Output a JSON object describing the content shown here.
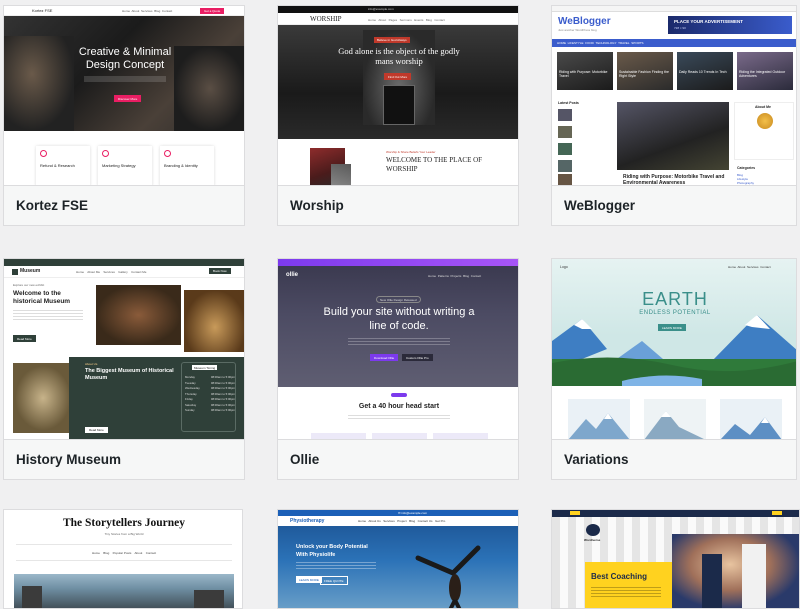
{
  "themes": [
    {
      "name": "Kortez FSE"
    },
    {
      "name": "Worship"
    },
    {
      "name": "WeBlogger"
    },
    {
      "name": "History Museum"
    },
    {
      "name": "Ollie"
    },
    {
      "name": "Variations"
    },
    {
      "name": "The Storytellers Journey"
    },
    {
      "name": "Physiotherapy"
    },
    {
      "name": "Best Coaching"
    }
  ],
  "kortez": {
    "logo": "Kortez FSE",
    "nav": [
      "Home",
      "About",
      "Services",
      "Blog",
      "Contact"
    ],
    "cta": "Get a Quote",
    "hero_title": "Creative & Minimal Design Concept",
    "hero_btn": "Discover More",
    "features": [
      "Refund & Research",
      "Marketing Strategy",
      "Branding & Identity"
    ]
  },
  "worship": {
    "logo": "WORSHIP",
    "topbar": "info@example.com",
    "hero_label": "Believe in God Always",
    "hero_title": "God alone is the object of the godly mans worship",
    "hero_btn": "Find Out More",
    "welcome_label": "Worship & Share Beliefs Your Leader",
    "welcome_title": "WELCOME TO THE PLACE OF WORSHIP"
  },
  "weblogger": {
    "logo": "WeBlogger",
    "tagline": "Just another WordPress blog",
    "ad": "PLACE YOUR ADVERTISEMENT",
    "ad_size": "728 × 90",
    "nav": [
      "HOME",
      "LIFESTYLE",
      "FOOD",
      "TECHNOLOGY",
      "TRAVEL",
      "SPORTS"
    ],
    "latest": "Latest Posts",
    "feature_title": "Riding with Purpose: Motorbike Travel and Environmental Awareness",
    "about": "About Me",
    "categories": "Categories",
    "cat_items": [
      "Blog",
      "Lifestyle",
      "Photography"
    ],
    "posts": [
      "Riding with Purpose: Motorbike Travel",
      "Sustainable Fashion Finding the Right Style",
      "Daily Reads 10 Trends In Tech",
      "Riding the Integrated Outdoor Adventures"
    ]
  },
  "museum": {
    "logo": "Museum",
    "nav": [
      "Home",
      "About Me",
      "Services",
      "Gallery",
      "Contact Me"
    ],
    "btn": "Book Now",
    "eyebrow": "Explore our new exhibit",
    "hero_title": "Welcome to the historical Museum",
    "hero_btn": "Read More",
    "about_label": "About Us",
    "about_title": "The Biggest Museum of Historical Museum",
    "about_btn": "Read More",
    "timing_title": "Museum Timing",
    "days": [
      "Monday",
      "Tuesday",
      "Wednesday",
      "Thursday",
      "Friday",
      "Saturday",
      "Sunday"
    ],
    "hours": "08:00am to 5:00pm"
  },
  "ollie": {
    "logo": "ollie",
    "nav": [
      "Home",
      "Patterns",
      "Projects",
      "Blog",
      "Contact"
    ],
    "badge": "New Ollie Design Released",
    "hero_title": "Build your site without writing a line of code.",
    "btn1": "Download Ollie",
    "btn2": "Custom Ollie Pro",
    "sub_title": "Get a 40 hour head start"
  },
  "variations": {
    "logo": "Logo",
    "nav": [
      "Home",
      "About",
      "Services",
      "Contact"
    ],
    "title": "EARTH",
    "subtitle": "ENDLESS POTENTIAL",
    "btn": "LEARN MORE"
  },
  "story": {
    "title": "The Storytellers Journey",
    "tagline": "Tiny Stories from a Big World",
    "nav": [
      "Home",
      "Blog",
      "Popular Posts",
      "About",
      "Contact"
    ]
  },
  "physio": {
    "logo": "Physiotherapy",
    "nav": [
      "Home",
      "About Us",
      "Services",
      "Project",
      "Blog",
      "Contact Us",
      "Get Pro"
    ],
    "hero_title": "Unlock your Body Potential With Physiolife",
    "btn1": "LEARN MORE",
    "btn2": "FREE QUOTE"
  },
  "coaching": {
    "logo": "Wordiverse",
    "banner": "Best Coaching"
  },
  "colors": {
    "kortez_accent": "#e91e63",
    "worship_accent": "#c0392b",
    "weblogger_blue": "#3a5ccc",
    "museum_green": "#2f4039",
    "ollie_purple": "#7c3aed",
    "earth_teal": "#3a8f8a",
    "physio_blue": "#1b5fb7",
    "coaching_yellow": "#ffd21f"
  }
}
